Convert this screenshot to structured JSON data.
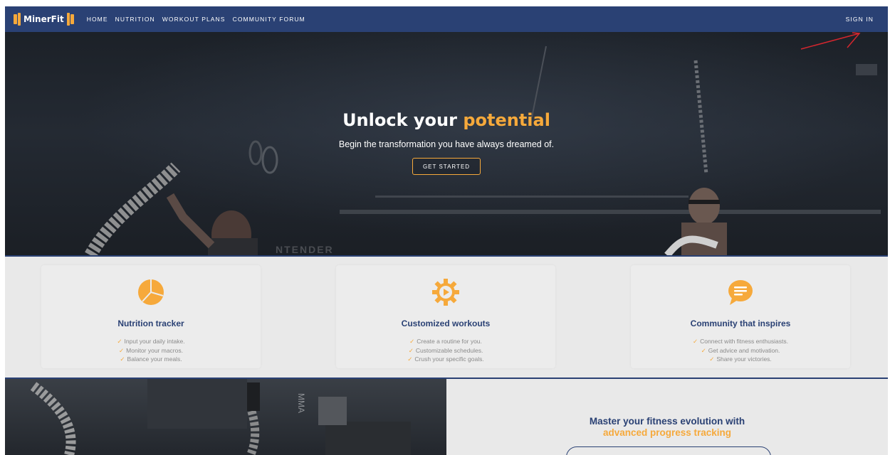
{
  "brand": {
    "name": "MinerFit",
    "accent": "#f6a93b",
    "primary": "#2a4174"
  },
  "nav": {
    "links": [
      "HOME",
      "NUTRITION",
      "WORKOUT PLANS",
      "COMMUNITY FORUM"
    ],
    "sign_in": "SIGN IN"
  },
  "hero": {
    "title_main": "Unlock your",
    "title_accent": "potential",
    "subtitle": "Begin the transformation you have always dreamed of.",
    "cta": "GET STARTED",
    "watermark": "NTENDER"
  },
  "features": [
    {
      "icon": "pie-chart-icon",
      "title": "Nutrition tracker",
      "items": [
        "Input your daily intake.",
        "Monitor your macros.",
        "Balance your meals."
      ]
    },
    {
      "icon": "gear-icon",
      "title": "Customized workouts",
      "items": [
        "Create a routine for you.",
        "Customizable schedules.",
        "Crush your specific goals."
      ]
    },
    {
      "icon": "chat-bubble-icon",
      "title": "Community that inspires",
      "items": [
        "Connect with fitness enthusiasts.",
        "Get advice and motivation.",
        "Share your victories."
      ]
    }
  ],
  "evolution": {
    "title": "Master your fitness evolution with",
    "subtitle": "advanced progress tracking"
  },
  "checkmark": "✓"
}
